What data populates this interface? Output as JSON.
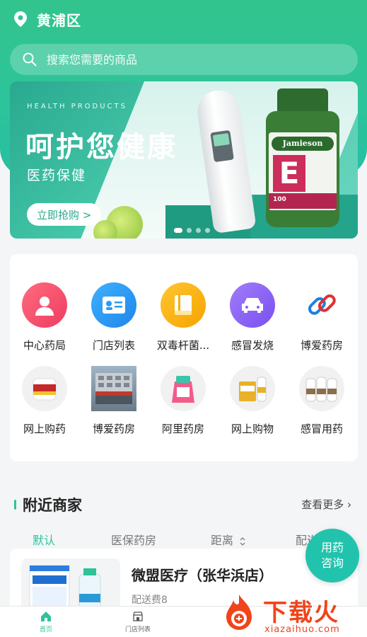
{
  "location": {
    "city": "黄浦区"
  },
  "search": {
    "placeholder": "搜索您需要的商品"
  },
  "banner": {
    "eyebrow": "HEALTH PRODUCTS",
    "headline": "呵护您健康",
    "subheadline": "医药保健",
    "cta_label": "立即抢购 >",
    "bottle_brand": "Jamieson",
    "bottle_letter": "E",
    "bottle_count": "100",
    "slide_count": 4,
    "active_slide": 1
  },
  "categories": [
    {
      "label": "中心药局",
      "icon": "person-icon",
      "color": "#f0506e"
    },
    {
      "label": "门店列表",
      "icon": "id-card-icon",
      "color": "#2b9cf2"
    },
    {
      "label": "双毒杆菌...",
      "icon": "book-icon",
      "color": "#f7b500"
    },
    {
      "label": "感冒发烧",
      "icon": "car-icon",
      "color": "#8b5cf6"
    },
    {
      "label": "博爱药房",
      "icon": "link-icon",
      "color": "#e03131"
    },
    {
      "label": "网上购药",
      "icon": "product-jar-icon",
      "color": "#f3f3f3"
    },
    {
      "label": "博爱药房",
      "icon": "store-photo-icon",
      "color": "#8aa1b1"
    },
    {
      "label": "阿里药房",
      "icon": "product-box-icon",
      "color": "#f3f3f3"
    },
    {
      "label": "网上购物",
      "icon": "product-caltrate-icon",
      "color": "#f3f3f3"
    },
    {
      "label": "感冒用药",
      "icon": "product-bottles-icon",
      "color": "#f3f3f3"
    }
  ],
  "nearby": {
    "title": "附近商家",
    "more_label": "查看更多",
    "tabs": [
      "默认",
      "医保药房",
      "距离",
      "配送"
    ],
    "active_tab": 0,
    "merchant": {
      "name": "微盟医疗（张华浜店）",
      "fee": "配送费8"
    }
  },
  "consult": {
    "line1": "用药",
    "line2": "咨询"
  },
  "tabbar": {
    "home_label": "首页",
    "stores_label": "门店列表"
  },
  "watermark": {
    "brand": "下载火",
    "url": "xiazaihuo.com"
  },
  "colors": {
    "primary": "#2ec39a",
    "watermark": "#f0441b"
  }
}
